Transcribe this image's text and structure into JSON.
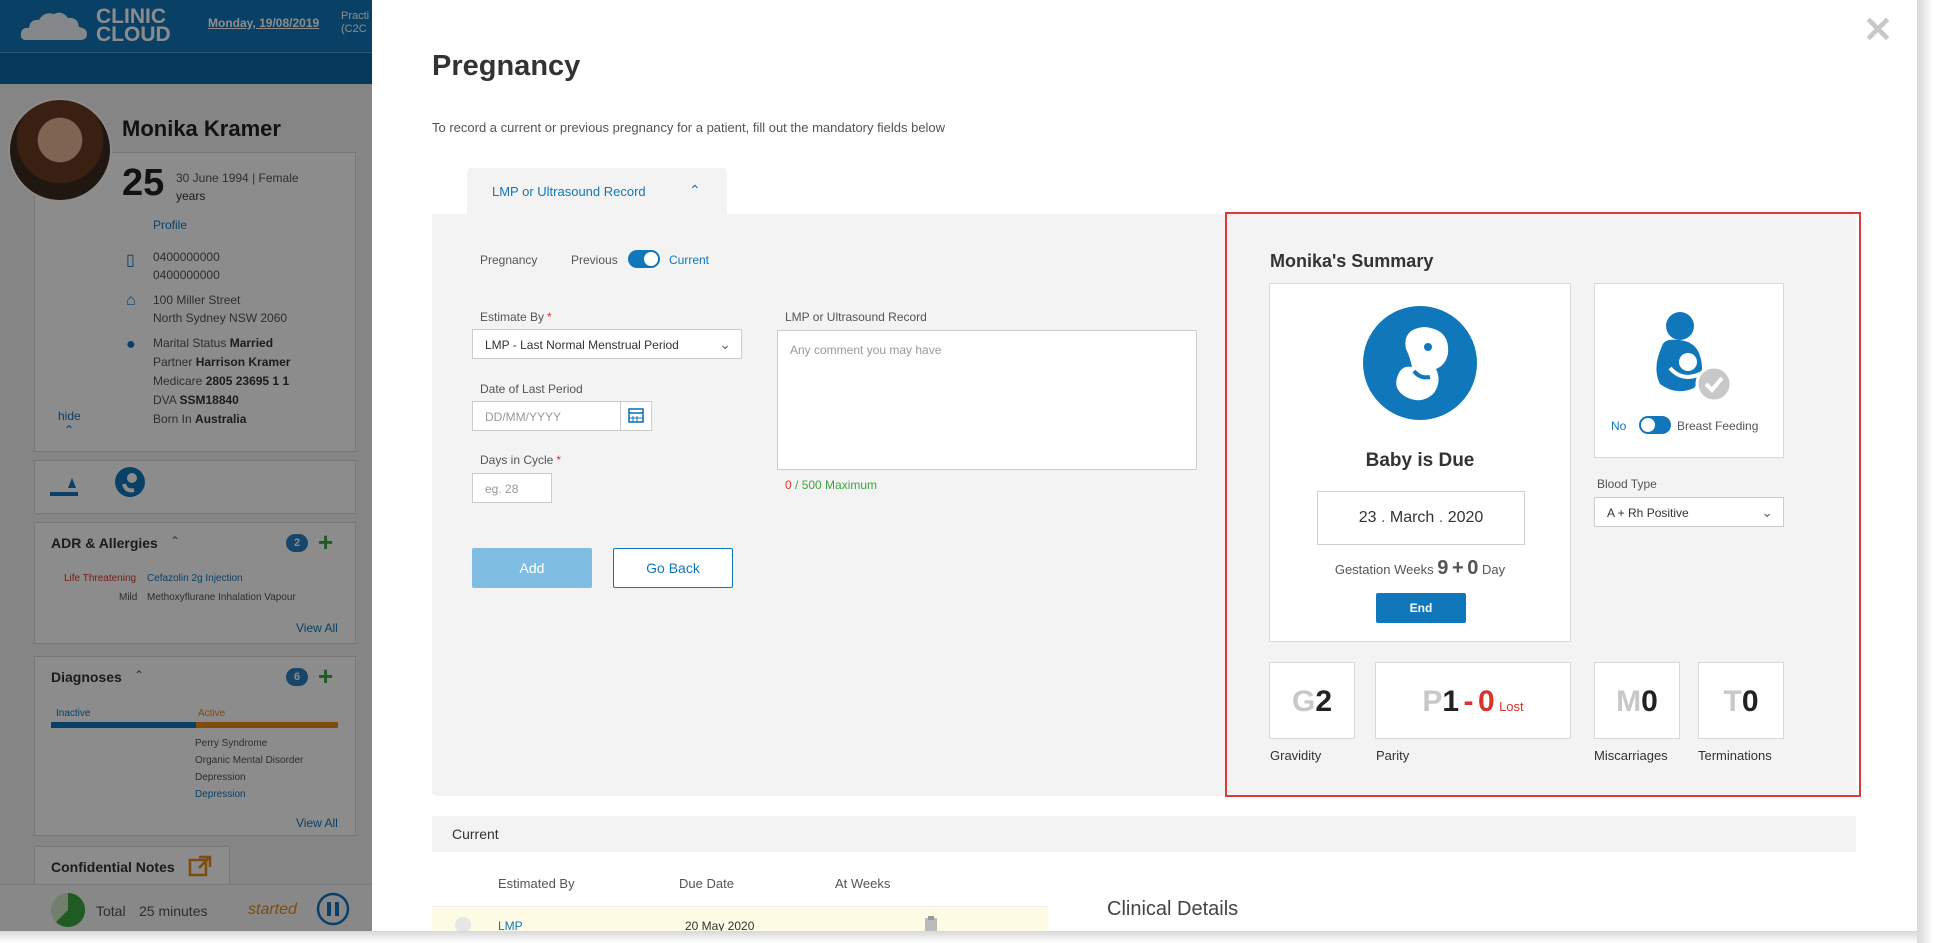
{
  "app": {
    "logo_text_1": "CLINIC",
    "logo_text_2": "CLOUD",
    "date": "Monday, 19/08/2019",
    "practice_line_1": "Practi",
    "practice_line_2": "(C2C"
  },
  "patient": {
    "name": "Monika Kramer",
    "age": "25",
    "age_unit": "years",
    "dob_gender": "30 June 1994 | Female",
    "profile_link": "Profile",
    "phone_1": "0400000000",
    "phone_2": "0400000000",
    "address_1": "100 Miller Street",
    "address_2": "North Sydney NSW 2060",
    "marital_label": "Marital Status",
    "marital_value": "Married",
    "partner_label": "Partner",
    "partner_value": "Harrison Kramer",
    "medicare_label": "Medicare",
    "medicare_value": "2805 23695 1 1",
    "dva_label": "DVA",
    "dva_value": "SSM18840",
    "born_label": "Born In",
    "born_value": "Australia",
    "hide_link": "hide"
  },
  "adr": {
    "title": "ADR & Allergies",
    "count": "2",
    "items": [
      {
        "severity": "Life Threatening",
        "name": "Cefazolin 2g Injection"
      },
      {
        "severity": "Mild",
        "name": "Methoxyflurane Inhalation Vapour"
      }
    ],
    "view_all": "View All"
  },
  "diagnoses": {
    "title": "Diagnoses",
    "count": "6",
    "inactive_label": "Inactive",
    "active_label": "Active",
    "items": [
      "Perry Syndrome",
      "Organic Mental Disorder",
      "Depression",
      "Depression"
    ],
    "view_all": "View All"
  },
  "notes": {
    "title": "Confidential Notes"
  },
  "timer": {
    "total_label": "Total",
    "duration": "25 minutes",
    "status": "started"
  },
  "modal": {
    "title": "Pregnancy",
    "description": "To record a current or previous pregnancy for a patient, fill out the mandatory fields below",
    "tab_label": "LMP or Ultrasound Record",
    "pregnancy_label": "Pregnancy",
    "toggle_off_label": "Previous",
    "toggle_on_label": "Current",
    "estimate_by_label": "Estimate By",
    "estimate_by_value": "LMP - Last Normal Menstrual Period",
    "date_last_period_label": "Date of Last Period",
    "date_last_period_placeholder": "DD/MM/YYYY",
    "days_in_cycle_label": "Days in Cycle",
    "days_in_cycle_placeholder": "eg. 28",
    "record_label": "LMP or Ultrasound Record",
    "record_placeholder": "Any comment you may have",
    "counter_value": "0",
    "counter_text": " / 500 Maximum",
    "add_button": "Add",
    "back_button": "Go Back"
  },
  "summary": {
    "title": "Monika's Summary",
    "baby_due_title": "Baby is Due",
    "due_day": "23",
    "due_month": "March",
    "due_year": "2020",
    "dot": ".",
    "gestation_label": "Gestation Weeks",
    "gestation_weeks": "9",
    "gestation_plus": "+",
    "gestation_days": "0",
    "gestation_day_label": "Day",
    "end_button": "End",
    "breast_no_label": "No",
    "breast_label": "Breast Feeding",
    "blood_type_label": "Blood Type",
    "blood_type_value": "A + Rh Positive",
    "gravidity": {
      "letter": "G",
      "value": "2",
      "caption": "Gravidity"
    },
    "parity": {
      "letter": "P",
      "value": "1",
      "dash": "-",
      "lost_value": "0",
      "lost_label": "Lost",
      "caption": "Parity"
    },
    "miscarriages": {
      "letter": "M",
      "value": "0",
      "caption": "Miscarriages"
    },
    "terminations": {
      "letter": "T",
      "value": "0",
      "caption": "Terminations"
    }
  },
  "current": {
    "title": "Current",
    "columns": [
      "Estimated By",
      "Due Date",
      "At Weeks"
    ],
    "row": {
      "estimated_by": "LMP",
      "due_date": "20 May 2020"
    },
    "clinical_title": "Clinical Details"
  },
  "colors": {
    "brand": "#1177bb",
    "danger": "#d9342b",
    "success": "#3aa640",
    "highlight_frame": "#d93a3a"
  }
}
